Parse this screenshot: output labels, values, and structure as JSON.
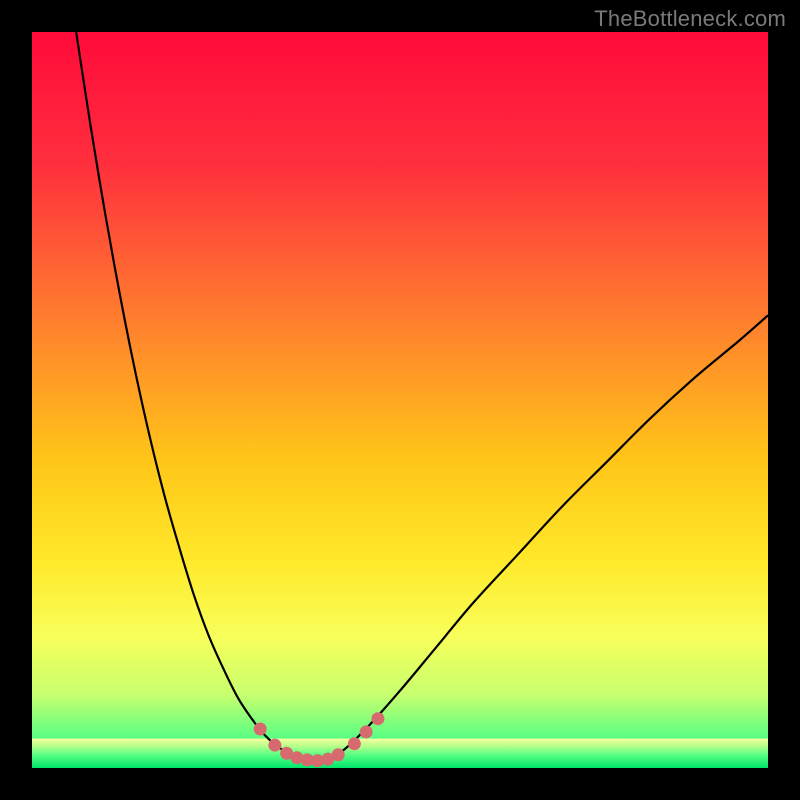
{
  "watermark": {
    "text": "TheBottleneck.com"
  },
  "chart_data": {
    "type": "line",
    "title": "",
    "xlabel": "",
    "ylabel": "",
    "xlim": [
      0,
      100
    ],
    "ylim": [
      0,
      100
    ],
    "grid": false,
    "legend": false,
    "background_gradient_stops": [
      {
        "offset": 0.0,
        "color": "#ff0a3a"
      },
      {
        "offset": 0.18,
        "color": "#ff2f3d"
      },
      {
        "offset": 0.38,
        "color": "#ff7a2f"
      },
      {
        "offset": 0.58,
        "color": "#ffc518"
      },
      {
        "offset": 0.72,
        "color": "#ffe92a"
      },
      {
        "offset": 0.82,
        "color": "#f8ff5a"
      },
      {
        "offset": 0.9,
        "color": "#c8ff6e"
      },
      {
        "offset": 0.96,
        "color": "#58ff84"
      },
      {
        "offset": 1.0,
        "color": "#00e56a"
      }
    ],
    "bottom_band": {
      "y_from": 96,
      "y_to": 100,
      "stops": [
        {
          "offset": 0.0,
          "color": "#f6ffa0"
        },
        {
          "offset": 0.25,
          "color": "#b8ff8a"
        },
        {
          "offset": 0.55,
          "color": "#58ff84"
        },
        {
          "offset": 1.0,
          "color": "#00e56a"
        }
      ]
    },
    "series": [
      {
        "name": "curve-left",
        "stroke": "#000000",
        "stroke_width": 2.2,
        "x": [
          6,
          8,
          10,
          12,
          14,
          16,
          18,
          20,
          22,
          24,
          26,
          28,
          30,
          31.5,
          33,
          34.5,
          35.8
        ],
        "y": [
          0,
          13,
          25,
          36,
          46,
          55,
          63,
          70,
          76.5,
          82,
          86.5,
          90.5,
          93.5,
          95.4,
          96.8,
          97.8,
          98.4
        ]
      },
      {
        "name": "valley-floor",
        "stroke": "#000000",
        "stroke_width": 2.2,
        "x": [
          35.8,
          37,
          38.5,
          40,
          41.2
        ],
        "y": [
          98.4,
          98.8,
          99.0,
          98.8,
          98.4
        ]
      },
      {
        "name": "curve-right",
        "stroke": "#000000",
        "stroke_width": 2.2,
        "x": [
          41.2,
          43,
          46,
          50,
          55,
          60,
          66,
          72,
          78,
          84,
          90,
          96,
          100
        ],
        "y": [
          98.4,
          97.0,
          94.0,
          89.5,
          83.5,
          77.5,
          71.0,
          64.5,
          58.5,
          52.5,
          47.0,
          42.0,
          38.5
        ]
      }
    ],
    "markers": {
      "color": "#d76a6f",
      "radius": 6.5,
      "points": [
        {
          "x": 31.0,
          "y": 94.7
        },
        {
          "x": 33.0,
          "y": 96.9
        },
        {
          "x": 34.6,
          "y": 98.0
        },
        {
          "x": 36.0,
          "y": 98.6
        },
        {
          "x": 37.4,
          "y": 98.9
        },
        {
          "x": 38.8,
          "y": 99.0
        },
        {
          "x": 40.2,
          "y": 98.8
        },
        {
          "x": 41.6,
          "y": 98.2
        },
        {
          "x": 43.8,
          "y": 96.7
        },
        {
          "x": 45.4,
          "y": 95.1
        },
        {
          "x": 47.0,
          "y": 93.3
        }
      ]
    }
  }
}
